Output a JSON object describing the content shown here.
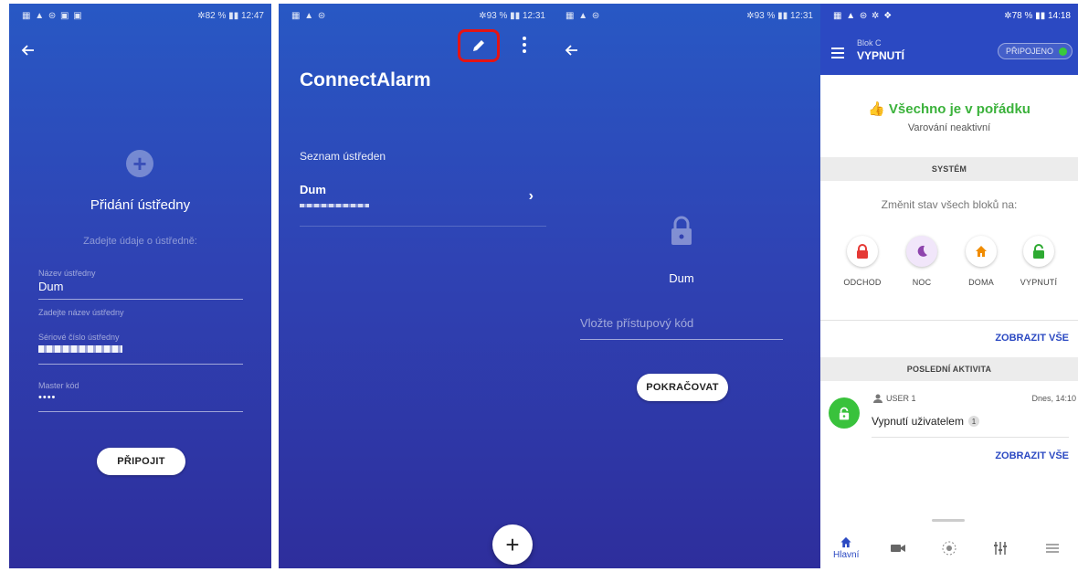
{
  "screen1": {
    "status_left": "▦ ▲ ⊜ ▣ ▣",
    "status_right": "✲82 % ▮▮ 12:47",
    "title": "Přidání ústředny",
    "subtitle": "Zadejte údaje o ústředně:",
    "name_label": "Název ústředny",
    "name_value": "Dum",
    "name_helper": "Zadejte název ústředny",
    "serial_label": "Sériové číslo ústředny",
    "master_label": "Master kód",
    "master_value": "••••",
    "connect_button": "PŘIPOJIT"
  },
  "screen2": {
    "status_left": "▦ ▲ ⊜",
    "status_right": "✲93 % ▮▮ 12:31",
    "app_title": "ConnectAlarm",
    "section_title": "Seznam ústředen",
    "items": [
      {
        "name": "Dum"
      }
    ],
    "fab_label": "+"
  },
  "screen3": {
    "status_left": "▦ ▲ ⊜",
    "status_right": "✲93 % ▮▮ 12:31",
    "panel_name": "Dum",
    "code_placeholder": "Vložte přístupový kód",
    "continue_button": "POKRAČOVAT"
  },
  "screen4": {
    "status_left": "▦ ▲ ⊜ ✲ ❖",
    "status_right": "✲78 % ▮▮ 14:18",
    "block_label": "Blok C",
    "block_state": "VYPNUTÍ",
    "connection_badge": "PŘIPOJENO",
    "ok_message": "Všechno je v pořádku",
    "ok_sub": "Varování neaktivní",
    "system_header": "SYSTÉM",
    "change_all": "Změnit stav všech bloků na:",
    "modes": [
      {
        "label": "ODCHOD",
        "icon": "lock-icon",
        "color": "#e53935",
        "bg": "#ffffff"
      },
      {
        "label": "NOC",
        "icon": "moon-icon",
        "color": "#8e44ad",
        "bg": "#f1e6fa"
      },
      {
        "label": "DOMA",
        "icon": "home-icon",
        "color": "#f08c00",
        "bg": "#ffffff"
      },
      {
        "label": "VYPNUTÍ",
        "icon": "unlock-icon",
        "color": "#2eaa32",
        "bg": "#ffffff"
      }
    ],
    "show_all_1": "ZOBRAZIT VŠE",
    "activity_header": "POSLEDNÍ AKTIVITA",
    "activity": {
      "user": "USER 1",
      "time": "Dnes, 14:10",
      "text": "Vypnutí uživatelem",
      "count": "1"
    },
    "show_all_2": "ZOBRAZIT VŠE",
    "nav": {
      "home_label": "Hlavní"
    }
  },
  "colors": {
    "accent": "#2b49c2",
    "ok_green": "#3bb23b",
    "highlight_red": "#e41414"
  }
}
